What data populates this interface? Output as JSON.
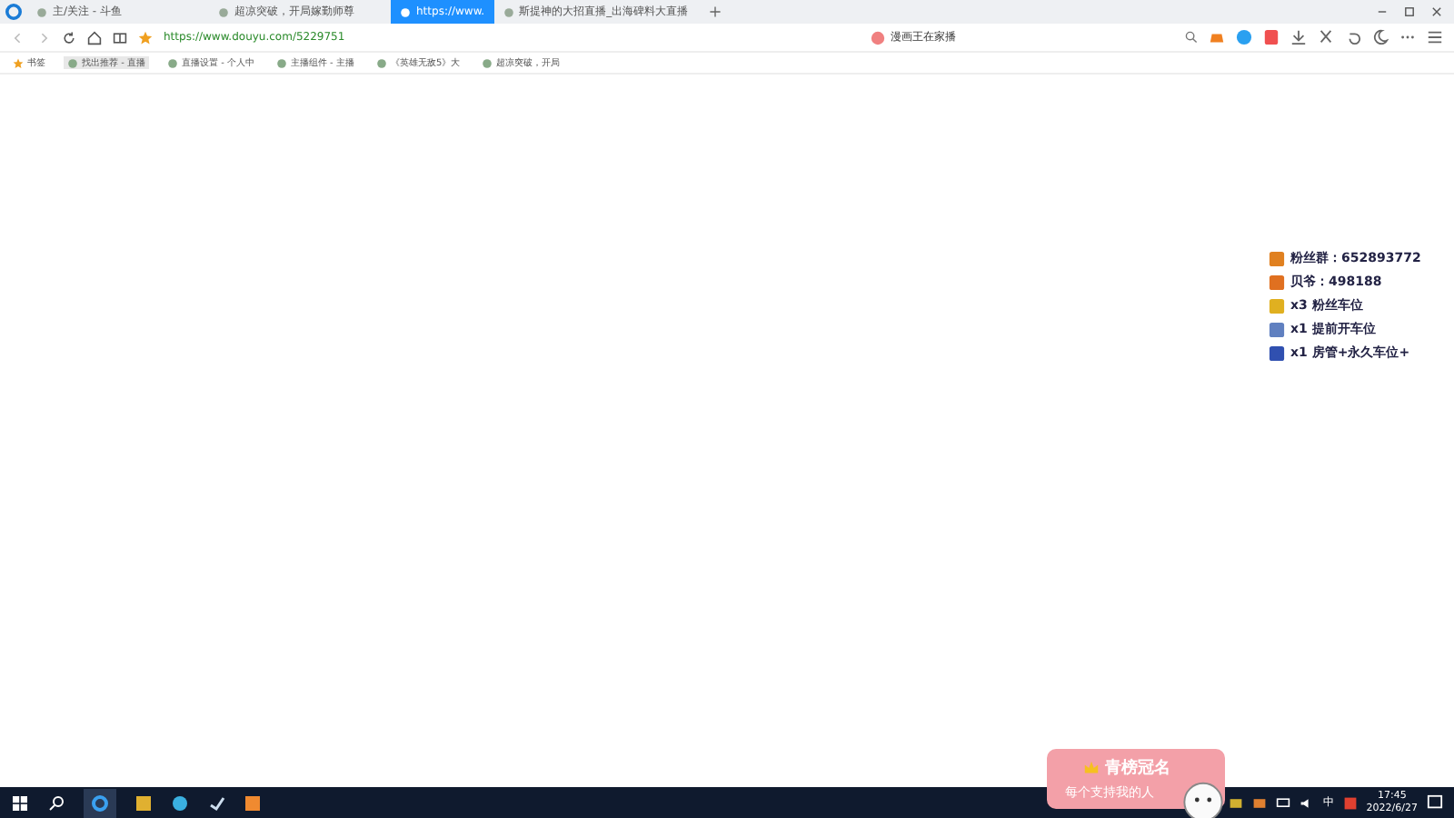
{
  "tabs": [
    {
      "label": "主/关注 - 斗鱼",
      "selected": false
    },
    {
      "label": "超凉突破，开局嫁勤师尊",
      "selected": false
    },
    {
      "label": "https://www.",
      "selected": true
    },
    {
      "label": "斯提神的大招直播_出海碑料大直播",
      "selected": false
    }
  ],
  "address": {
    "url_prefix": "https://",
    "url_rest": "www.douyu.com/5229751"
  },
  "search_box": {
    "value": "漫画王在家播"
  },
  "bookmarks": [
    {
      "label": "书签"
    },
    {
      "label": "找出推荐 - 直播"
    },
    {
      "label": "直播设置 - 个人中"
    },
    {
      "label": "主播组件 - 主播"
    },
    {
      "label": "《英雄无敌5》大"
    },
    {
      "label": "超凉突破，开局"
    }
  ],
  "overlay_lines": [
    {
      "text": "粉丝群：652893772"
    },
    {
      "text": "贝爷：498188"
    },
    {
      "text": "x3 粉丝车位"
    },
    {
      "text": "x1 提前开车位"
    },
    {
      "text": "x1 房管+永久车位+"
    }
  ],
  "banner": {
    "title": "青榜冠名",
    "subtitle": "每个支持我的人"
  },
  "taskbar": {
    "ime": "中",
    "time": "17:45",
    "date": "2022/6/27"
  }
}
